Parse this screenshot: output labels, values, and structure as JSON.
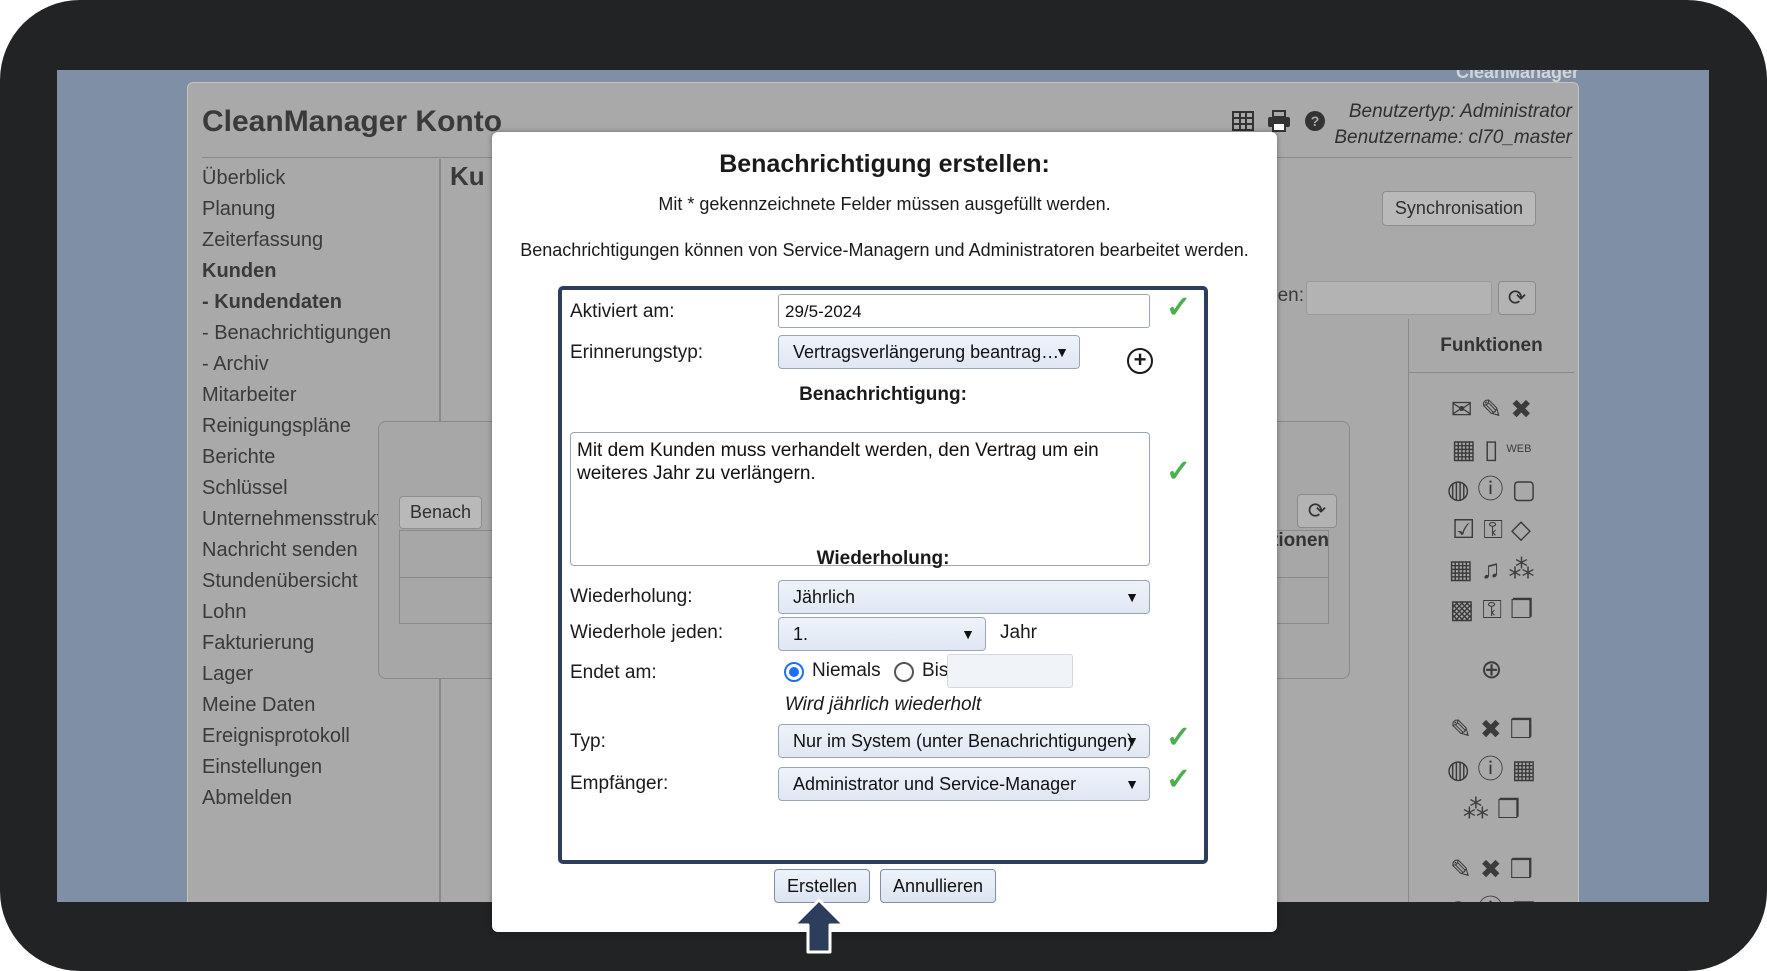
{
  "background": {
    "brand": "CleanManager",
    "title": "CleanManager Konto",
    "user_type": "Benutzertyp: Administrator",
    "username": "Benutzername: cl70_master",
    "icons": [
      "table-icon",
      "print-icon",
      "help-icon"
    ],
    "nav": [
      "Überblick",
      "Planung",
      "Zeiterfassung",
      "Kunden",
      "- Kundendaten",
      "- Benachrichtigungen",
      "- Archiv",
      "Mitarbeiter",
      "Reinigungspläne",
      "Berichte",
      "Schlüssel",
      "Unternehmensstruktur",
      "Nachricht senden",
      "Stundenübersicht",
      "Lohn",
      "Fakturierung",
      "Lager",
      "Meine Daten",
      "Ereignisprotokoll",
      "Einstellungen",
      "Abmelden"
    ],
    "section_partial": "Ku",
    "sync_button": "Synchronisation",
    "filter_label_partial": "en:",
    "functions_header": "Funktionen",
    "panel_button_partial": "Benach",
    "panel_header_partial": "ktionen"
  },
  "modal": {
    "title": "Benachrichtigung erstellen:",
    "required_note": "Mit * gekennzeichnete Felder müssen ausgefüllt werden.",
    "edit_note": "Benachrichtigungen können von Service-Managern und Administratoren bearbeitet werden.",
    "fields": {
      "activated_label": "Aktiviert am:",
      "activated_value": "29/5-2024",
      "reminder_label": "Erinnerungstyp:",
      "reminder_value": "Vertragsverlängerung beantrag…",
      "notification_section": "Benachrichtigung:",
      "notification_text": "Mit dem Kunden muss verhandelt werden, den Vertrag um ein weiteres Jahr zu verlängern.",
      "repeat_section": "Wiederholung:",
      "repeat_label": "Wiederholung:",
      "repeat_value": "Jährlich",
      "repeat_every_label": "Wiederhole jeden:",
      "repeat_every_value": "1.",
      "repeat_every_unit": "Jahr",
      "ends_label": "Endet am:",
      "ends_never": "Niemals",
      "ends_until": "Bis:",
      "repeat_summary": "Wird jährlich wiederholt",
      "type_label": "Typ:",
      "type_value": "Nur im System (unter Benachrichtigungen)",
      "recipient_label": "Empfänger:",
      "recipient_value": "Administrator und Service-Manager"
    },
    "buttons": {
      "create": "Erstellen",
      "cancel": "Annullieren"
    }
  },
  "colors": {
    "form_border": "#2d3e5c",
    "check": "#4caf50",
    "radio": "#1e6ff1",
    "frame": "#222325"
  }
}
